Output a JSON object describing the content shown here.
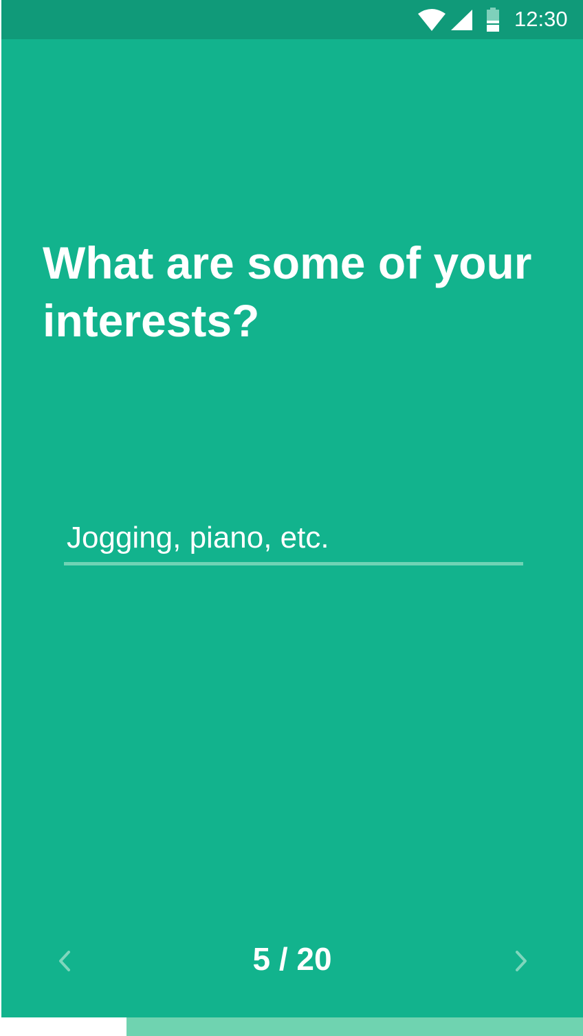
{
  "status_bar": {
    "time": "12:30",
    "icons": [
      "wifi-icon",
      "signal-icon",
      "battery-icon"
    ]
  },
  "question": {
    "text": "What are some of your interests?"
  },
  "answer": {
    "value": "",
    "placeholder": "Jogging, piano, etc."
  },
  "navigation": {
    "prev_icon": "chevron-left-icon",
    "next_icon": "chevron-right-icon",
    "counter": "5 / 20"
  },
  "progress": {
    "current": 5,
    "total": 20,
    "fraction": 0.25
  },
  "colors": {
    "background": "#12b38d",
    "status_bar": "#109a79",
    "underline": "#6fd3b5",
    "progress_track": "#6fd3b0",
    "progress_fill": "#ffffff",
    "text": "#ffffff"
  }
}
